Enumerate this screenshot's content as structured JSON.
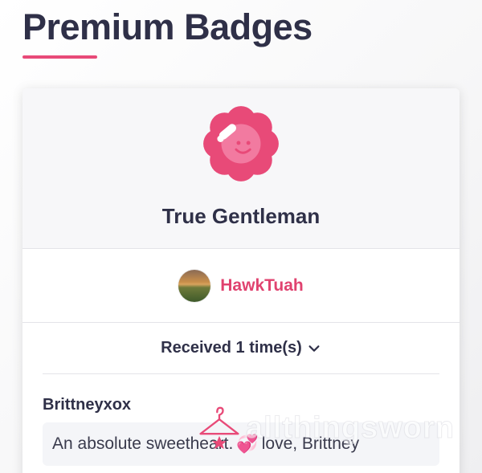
{
  "page": {
    "title": "Premium Badges"
  },
  "badge": {
    "name": "True Gentleman",
    "icon": "flower-smiley-salute-icon",
    "color": "#e84a78"
  },
  "owner": {
    "username": "HawkTuah",
    "avatar": "sunset-landscape-avatar"
  },
  "received": {
    "label": "Received 1 time(s)",
    "icon": "chevron-down-icon"
  },
  "entries": [
    {
      "username": "Brittneyxox",
      "message_before": "An absolute sweetheart.",
      "emoji": "💞",
      "message_after": "love, Brittney"
    }
  ],
  "watermark": {
    "text": "allthingsworn",
    "icon": "hanger-icon"
  },
  "colors": {
    "accent": "#e84a78",
    "heading": "#2f3048"
  }
}
